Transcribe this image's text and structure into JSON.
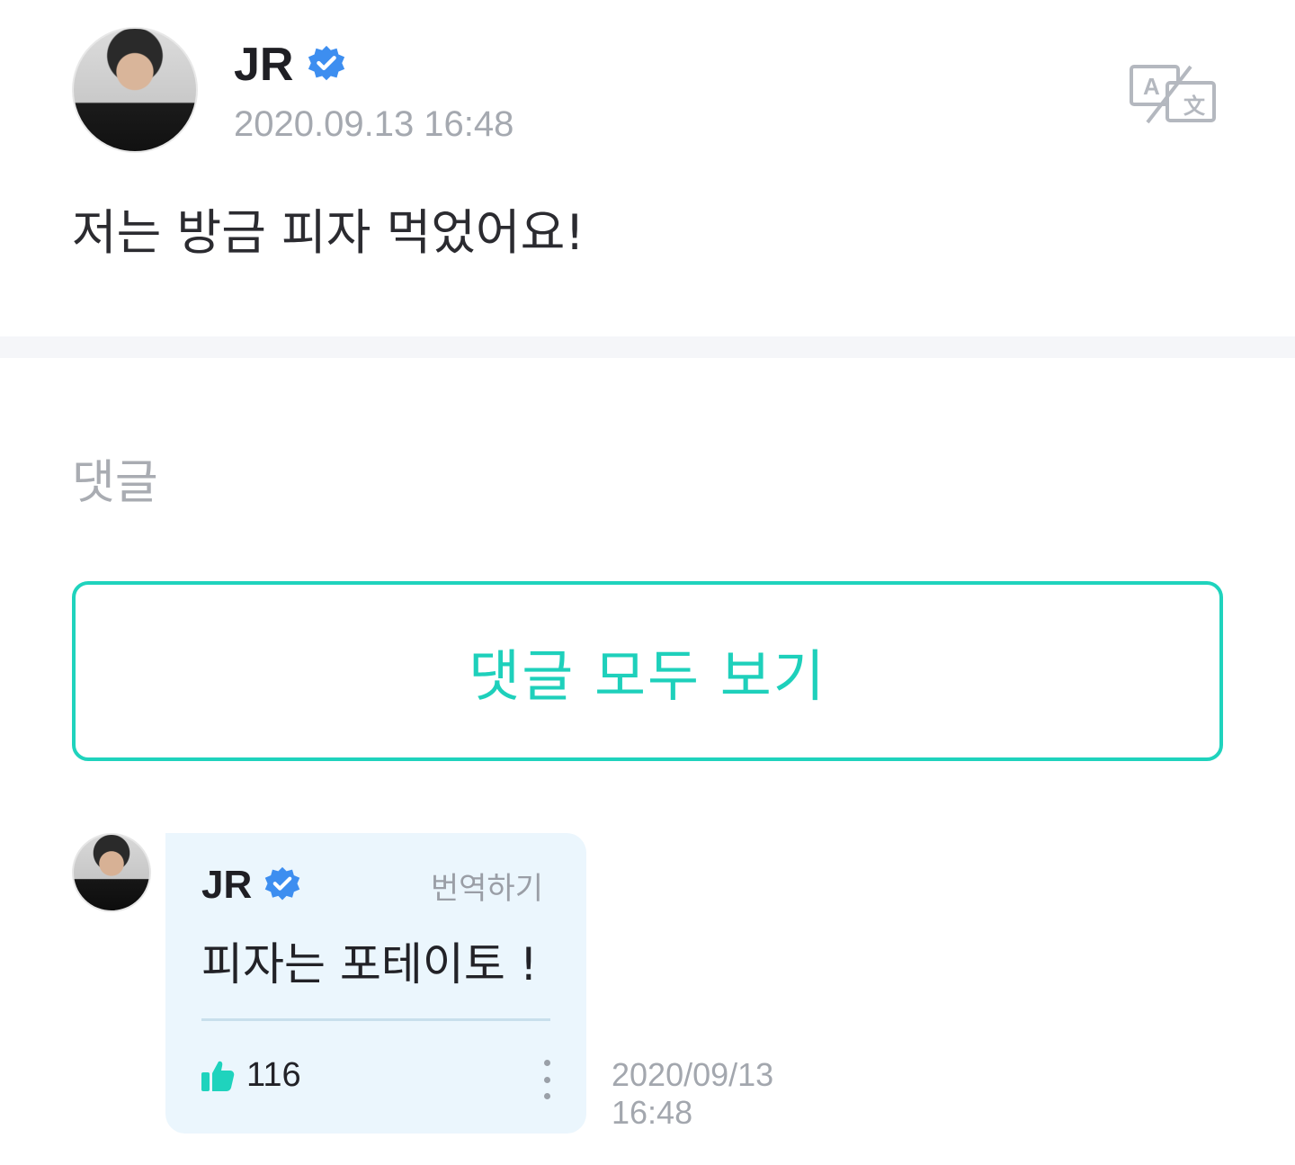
{
  "post": {
    "author": "JR",
    "verified_icon": "verified-badge-icon",
    "timestamp": "2020.09.13 16:48",
    "translate_icon": "translate-icon",
    "body": "저는 방금 피자 먹었어요!"
  },
  "comments_section": {
    "heading": "댓글",
    "view_all_label": "댓글 모두 보기"
  },
  "comment": {
    "author": "JR",
    "translate_label": "번역하기",
    "text": "피자는 포테이토 !",
    "like_count": "116",
    "date": "2020/09/13",
    "time": "16:48"
  },
  "colors": {
    "accent": "#1fd3bd",
    "verified": "#3d8ef0",
    "bubble": "#ebf6fd",
    "muted": "#a5a9b0"
  }
}
